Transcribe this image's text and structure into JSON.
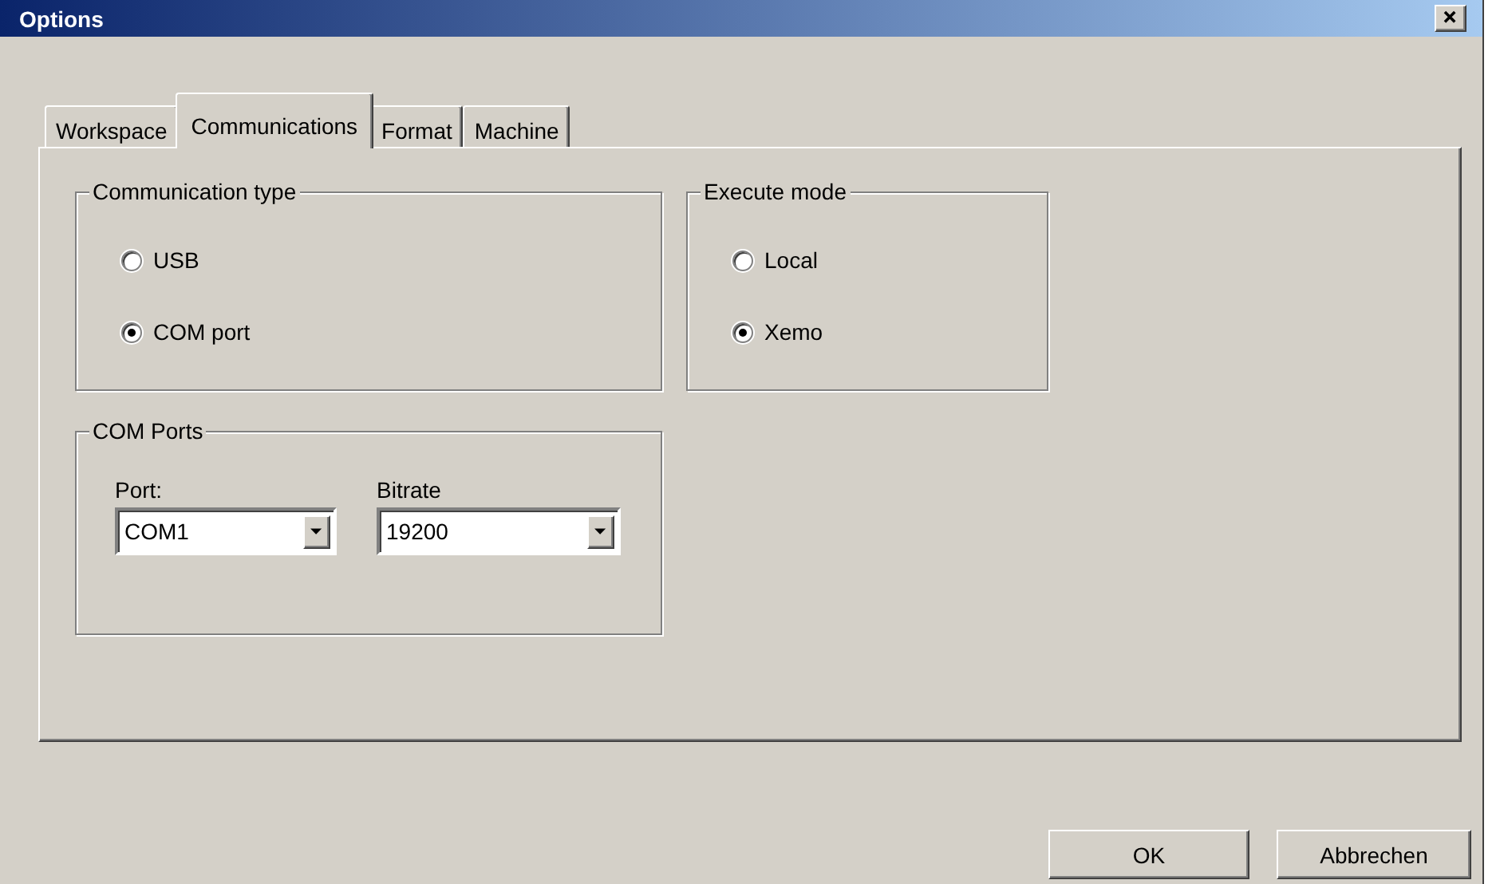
{
  "window": {
    "title": "Options"
  },
  "tabs": [
    {
      "label": "Workspace",
      "selected": false
    },
    {
      "label": "Communications",
      "selected": true
    },
    {
      "label": "Format",
      "selected": false
    },
    {
      "label": "Machine",
      "selected": false
    }
  ],
  "groups": [
    {
      "title": "Communication type",
      "kind": "radios",
      "options": [
        {
          "label": "USB",
          "selected": false
        },
        {
          "label": "COM port",
          "selected": true
        }
      ]
    },
    {
      "title": "Execute mode",
      "kind": "radios",
      "options": [
        {
          "label": "Local",
          "selected": false
        },
        {
          "label": "Xemo",
          "selected": true
        }
      ]
    },
    {
      "title": "COM Ports",
      "kind": "combos",
      "fields": [
        {
          "label": "Port:",
          "value": "COM1"
        },
        {
          "label": "Bitrate",
          "value": "19200"
        }
      ]
    }
  ],
  "buttons": [
    {
      "label": "OK"
    },
    {
      "label": "Abbrechen"
    }
  ]
}
